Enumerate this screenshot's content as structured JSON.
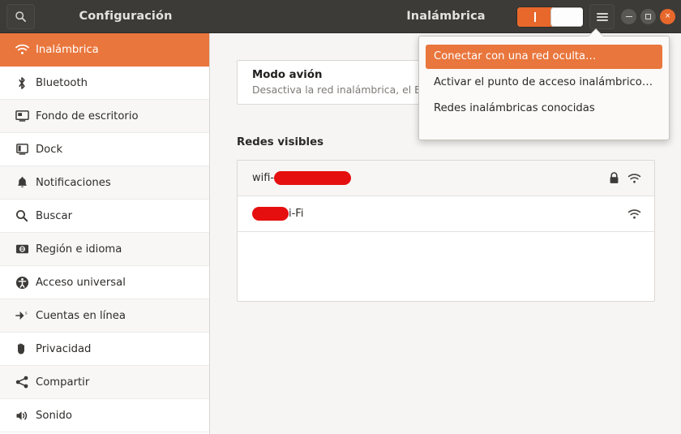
{
  "window": {
    "app_title": "Configuración",
    "page_title": "Inalámbrica",
    "search_icon": "search-icon",
    "menu_icon": "hamburger-menu-icon",
    "wifi_toggle": {
      "state": "on",
      "label": "|"
    },
    "controls": {
      "minimize": "minimize-icon",
      "maximize": "maximize-icon",
      "close": "close-icon",
      "close_glyph": "×"
    },
    "accent_color": "#e9763c",
    "titlebar_color": "#3c3b37"
  },
  "sidebar": {
    "items": [
      {
        "label": "Inalámbrica",
        "icon": "wifi-icon",
        "active": true
      },
      {
        "label": "Bluetooth",
        "icon": "bluetooth-icon",
        "active": false
      },
      {
        "label": "Fondo de escritorio",
        "icon": "wallpaper-icon",
        "active": false
      },
      {
        "label": "Dock",
        "icon": "dock-icon",
        "active": false
      },
      {
        "label": "Notificaciones",
        "icon": "bell-icon",
        "active": false
      },
      {
        "label": "Buscar",
        "icon": "search-icon",
        "active": false
      },
      {
        "label": "Región e idioma",
        "icon": "globe-keyboard-icon",
        "active": false
      },
      {
        "label": "Acceso universal",
        "icon": "accessibility-icon",
        "active": false
      },
      {
        "label": "Cuentas en línea",
        "icon": "online-accounts-icon",
        "active": false
      },
      {
        "label": "Privacidad",
        "icon": "hand-icon",
        "active": false
      },
      {
        "label": "Compartir",
        "icon": "share-icon",
        "active": false
      },
      {
        "label": "Sonido",
        "icon": "speaker-icon",
        "active": false
      }
    ]
  },
  "main": {
    "airplane_card": {
      "title": "Modo avión",
      "subtitle": "Desactiva la red inalámbrica, el Blu"
    },
    "networks_section": {
      "heading": "Redes visibles",
      "rows": [
        {
          "prefix": "wifi-",
          "redaction_width": 95,
          "suffix": "",
          "locked": true,
          "lock_icon": "lock-icon",
          "signal_icon": "wifi-signal-icon"
        },
        {
          "prefix": "",
          "redaction_width": 45,
          "suffix": "i-Fi",
          "locked": false,
          "lock_icon": "",
          "signal_icon": "wifi-signal-icon"
        }
      ]
    }
  },
  "popup_menu": {
    "items": [
      {
        "label": "Conectar con una red oculta…",
        "highlighted": true
      },
      {
        "label": "Activar el punto de acceso inalámbrico…",
        "highlighted": false
      },
      {
        "label": "Redes inalámbricas conocidas",
        "highlighted": false
      }
    ]
  }
}
